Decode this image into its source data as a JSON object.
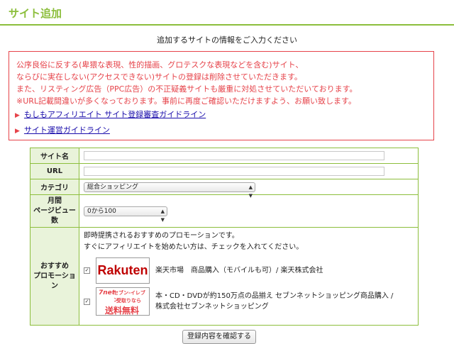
{
  "header": {
    "title": "サイト追加"
  },
  "intro": "追加するサイトの情報をご入力ください",
  "notice": {
    "lines": [
      "公序良俗に反する(卑猥な表現、性的描画、グロテスクな表現などを含む)サイト、",
      "ならびに実在しない(アクセスできない)サイトの登録は削除させていただきます。",
      "また、リスティング広告（PPC広告）の不正疑義サイトも厳重に対処させていただいております。",
      "※URL記載間違いが多くなっております。事前に再度ご確認いただけますよう、お願い致します。"
    ],
    "links": [
      {
        "label": "もしもアフィリエイト サイト登録審査ガイドライン"
      },
      {
        "label": "サイト運営ガイドライン"
      }
    ]
  },
  "form": {
    "site_name": {
      "label": "サイト名",
      "value": ""
    },
    "url": {
      "label": "URL",
      "value": ""
    },
    "category": {
      "label": "カテゴリ",
      "selected": "総合ショッピング"
    },
    "pageviews": {
      "label_lines": [
        "月間",
        "ページビュー",
        "数"
      ],
      "selected": "0から100"
    },
    "promotions": {
      "label_lines": [
        "おすすめ",
        "プロモーショ",
        "ン"
      ],
      "intro_lines": [
        "即時提携されるおすすめのプロモーションです。",
        "すぐにアフィリエイトを始めたい方は、チェックを入れてください。"
      ],
      "items": [
        {
          "checked": true,
          "logo_text": "Rakuten",
          "desc_lines": [
            "楽天市場　商品購入（モバイルも可）/ 楽天株式会社"
          ]
        },
        {
          "checked": true,
          "logo_lines": [
            "7net",
            "セブン-イレブン",
            "受取りなら",
            "送料無料"
          ],
          "desc_lines": [
            "本・CD・DVDが約150万点の品揃え セブンネットショッピング商品購入 /",
            "株式会社セブンネットショッピング"
          ]
        }
      ]
    }
  },
  "submit_label": "登録内容を確認する",
  "colors": {
    "accent": "#8cbe3c",
    "warning": "#e6434a",
    "label_bg": "#e9f3da",
    "link": "#1a0dab"
  }
}
